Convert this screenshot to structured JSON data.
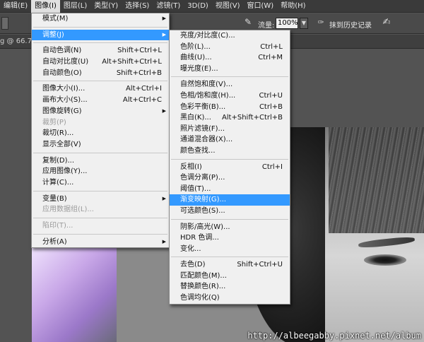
{
  "menubar": {
    "items": [
      "编辑(E)",
      "图像(I)",
      "图层(L)",
      "类型(Y)",
      "选择(S)",
      "滤镜(T)",
      "3D(D)",
      "视图(V)",
      "窗口(W)",
      "帮助(H)"
    ]
  },
  "options_bar": {
    "flow_label": "流量:",
    "flow_value": "100%",
    "history_label": "抹到历史记录"
  },
  "doc_tab": {
    "label": "g @ 66.7"
  },
  "image_menu": {
    "items": [
      {
        "label": "模式(M)",
        "submenu": true
      },
      {
        "label": "调整(J)",
        "submenu": true,
        "highlighted": true
      },
      {
        "label": "自动色调(N)",
        "shortcut": "Shift+Ctrl+L"
      },
      {
        "label": "自动对比度(U)",
        "shortcut": "Alt+Shift+Ctrl+L"
      },
      {
        "label": "自动颜色(O)",
        "shortcut": "Shift+Ctrl+B"
      },
      {
        "label": "图像大小(I)...",
        "shortcut": "Alt+Ctrl+I"
      },
      {
        "label": "画布大小(S)...",
        "shortcut": "Alt+Ctrl+C"
      },
      {
        "label": "图像旋转(G)",
        "submenu": true
      },
      {
        "label": "裁剪(P)",
        "disabled": true
      },
      {
        "label": "裁切(R)..."
      },
      {
        "label": "显示全部(V)"
      },
      {
        "label": "复制(D)..."
      },
      {
        "label": "应用图像(Y)..."
      },
      {
        "label": "计算(C)..."
      },
      {
        "label": "变量(B)",
        "submenu": true
      },
      {
        "label": "应用数据组(L)...",
        "disabled": true
      },
      {
        "label": "陷印(T)...",
        "disabled": true
      },
      {
        "label": "分析(A)",
        "submenu": true
      }
    ]
  },
  "adjust_menu": {
    "items": [
      {
        "label": "亮度/对比度(C)..."
      },
      {
        "label": "色阶(L)...",
        "shortcut": "Ctrl+L"
      },
      {
        "label": "曲线(U)...",
        "shortcut": "Ctrl+M"
      },
      {
        "label": "曝光度(E)..."
      },
      {
        "label": "自然饱和度(V)..."
      },
      {
        "label": "色相/饱和度(H)...",
        "shortcut": "Ctrl+U"
      },
      {
        "label": "色彩平衡(B)...",
        "shortcut": "Ctrl+B"
      },
      {
        "label": "黑白(K)...",
        "shortcut": "Alt+Shift+Ctrl+B"
      },
      {
        "label": "照片滤镜(F)..."
      },
      {
        "label": "通道混合器(X)..."
      },
      {
        "label": "颜色查找..."
      },
      {
        "label": "反相(I)",
        "shortcut": "Ctrl+I"
      },
      {
        "label": "色调分离(P)..."
      },
      {
        "label": "阈值(T)..."
      },
      {
        "label": "渐变映射(G)...",
        "highlighted": true
      },
      {
        "label": "可选颜色(S)..."
      },
      {
        "label": "阴影/高光(W)..."
      },
      {
        "label": "HDR 色调..."
      },
      {
        "label": "变化..."
      },
      {
        "label": "去色(D)",
        "shortcut": "Shift+Ctrl+U"
      },
      {
        "label": "匹配颜色(M)..."
      },
      {
        "label": "替换颜色(R)..."
      },
      {
        "label": "色调均化(Q)"
      }
    ]
  },
  "watermark": "http://albeegabby.pixnet.net/album",
  "colors": {
    "highlight": "#3399ff",
    "menu_bg": "#f0f0f0",
    "app_bg": "#535353"
  }
}
